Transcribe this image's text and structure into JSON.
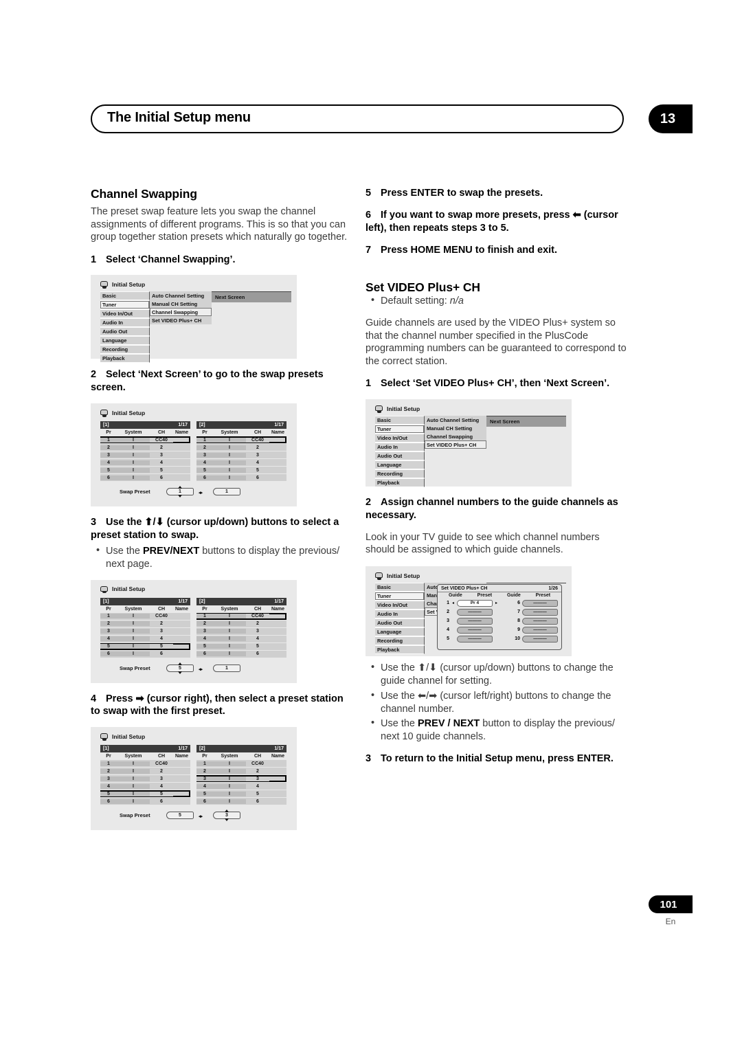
{
  "header": {
    "title": "The Initial Setup menu",
    "chapter": "13"
  },
  "footer": {
    "page": "101",
    "language": "En"
  },
  "left_column": {
    "section_title": "Channel Swapping",
    "intro": "The preset swap feature lets you swap the channel assignments of different programs. This is so that you can group together station presets which naturally go together.",
    "step1": "Select ‘Channel Swapping’.",
    "step1_num": "1",
    "step2": "Select ‘Next Screen’ to go to the swap presets screen.",
    "step2_num": "2",
    "step3": "Use the ⬆/⬇ (cursor up/down) buttons to select a preset station to swap.",
    "step3_num": "3",
    "step3_bullet_a": "Use the ",
    "step3_bullet_b": "PREV/NEXT",
    "step3_bullet_c": " buttons to display the previous/ next page.",
    "step4": "Press ➡ (cursor right), then select a preset station to swap with the first preset.",
    "step4_num": "4"
  },
  "right_column": {
    "step5_num": "5",
    "step5": "Press ENTER to swap the presets.",
    "step6_num": "6",
    "step6": "If you want to swap more presets, press ⬅ (cursor left), then repeats steps 3 to 5.",
    "step7_num": "7",
    "step7": "Press HOME MENU to finish and exit.",
    "section_title": "Set VIDEO Plus+ CH",
    "default_setting_label": "Default setting: ",
    "default_setting_value": "n/a",
    "intro": "Guide channels are used by the VIDEO Plus+ system so that the channel number specified in the PlusCode programming numbers can be guaranteed to correspond to the correct station.",
    "step1_num": "1",
    "step1": "Select ‘Set VIDEO Plus+ CH’, then ‘Next Screen’.",
    "step2_num": "2",
    "step2": "Assign channel numbers to the guide channels as necessary.",
    "step2_body": "Look in your TV guide to see which channel numbers should be assigned to which guide channels.",
    "bullet1_a": "Use the ⬆/⬇ (cursor up/down) buttons to change the guide channel for setting.",
    "bullet2_a": "Use the ⬅/➡ (cursor left/right) buttons to change the channel number.",
    "bullet3_a": "Use the ",
    "bullet3_b": "PREV / NEXT",
    "bullet3_c": " button to display the previous/ next 10 guide channels.",
    "step3_num": "3",
    "step3": "To return to the Initial Setup menu, press ENTER."
  },
  "osd": {
    "title": "Initial Setup",
    "categories": [
      "Basic",
      "Tuner",
      "Video In/Out",
      "Audio In",
      "Audio Out",
      "Language",
      "Recording",
      "Playback"
    ],
    "selected_category": "Tuner",
    "tuner_items": [
      "Auto Channel Setting",
      "Manual CH Setting",
      "Channel Swapping",
      "Set VIDEO Plus+ CH"
    ],
    "next_screen": "Next Screen",
    "menu1_selected_item": "Channel Swapping",
    "menu2_selected_item": "Set VIDEO Plus+ CH"
  },
  "swap_table": {
    "columns": [
      "Pr",
      "System",
      "CH",
      "Name"
    ],
    "panel1_label": "[1]",
    "panel2_label": "[2]",
    "page_indicator": "1/17",
    "swap_preset_label": "Swap Preset",
    "rows": [
      {
        "pr": "1",
        "system": "I",
        "ch": "CC40",
        "name": ""
      },
      {
        "pr": "2",
        "system": "I",
        "ch": "2",
        "name": ""
      },
      {
        "pr": "3",
        "system": "I",
        "ch": "3",
        "name": ""
      },
      {
        "pr": "4",
        "system": "I",
        "ch": "4",
        "name": ""
      },
      {
        "pr": "5",
        "system": "I",
        "ch": "5",
        "name": ""
      },
      {
        "pr": "6",
        "system": "I",
        "ch": "6",
        "name": ""
      }
    ],
    "fig_a": {
      "left_highlight_row": 1,
      "right_highlight_row": 1,
      "left_value": "1",
      "right_value": "1",
      "left_spinner": true,
      "right_spinner": false
    },
    "fig_b": {
      "left_highlight_row": 5,
      "right_highlight_row": 1,
      "left_value": "5",
      "right_value": "1",
      "left_spinner": true,
      "right_spinner": false
    },
    "fig_c": {
      "left_highlight_row": 5,
      "right_highlight_row": 3,
      "left_value": "5",
      "right_value": "3",
      "left_spinner": false,
      "right_spinner": true
    }
  },
  "guide_screen": {
    "title": "Set VIDEO Plus+ CH",
    "page_indicator": "1/26",
    "col_guide": "Guide",
    "col_preset": "Preset",
    "left_rows": [
      {
        "guide": "1",
        "preset": "Pr 4",
        "active": true
      },
      {
        "guide": "2",
        "preset": "———",
        "active": false
      },
      {
        "guide": "3",
        "preset": "———",
        "active": false
      },
      {
        "guide": "4",
        "preset": "———",
        "active": false
      },
      {
        "guide": "5",
        "preset": "———",
        "active": false
      }
    ],
    "right_rows": [
      {
        "guide": "6",
        "preset": "———",
        "active": false
      },
      {
        "guide": "7",
        "preset": "———",
        "active": false
      },
      {
        "guide": "8",
        "preset": "———",
        "active": false
      },
      {
        "guide": "9",
        "preset": "———",
        "active": false
      },
      {
        "guide": "10",
        "preset": "———",
        "active": false
      }
    ],
    "menu_truncated": [
      "Auto C",
      "Manu",
      "Chann",
      "Set VID"
    ]
  }
}
